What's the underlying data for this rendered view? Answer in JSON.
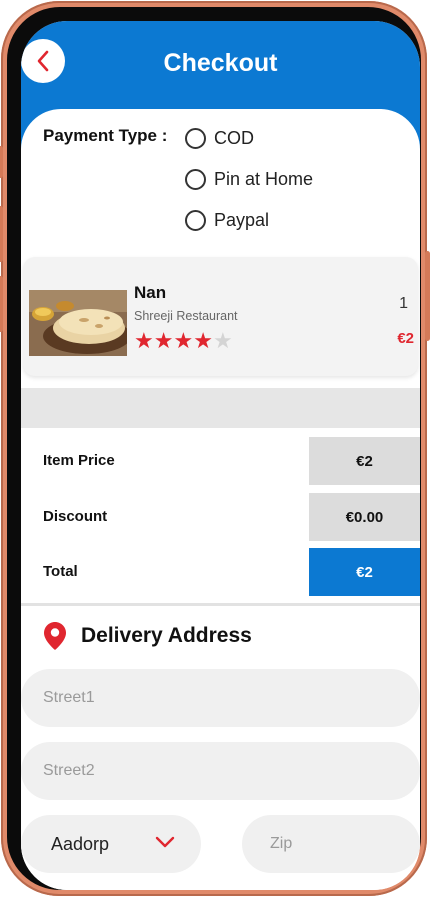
{
  "header": {
    "title": "Checkout",
    "back_icon": "chevron-left-icon"
  },
  "payment": {
    "label": "Payment Type :",
    "options": [
      "COD",
      "Pin at Home",
      "Paypal"
    ]
  },
  "item": {
    "name": "Nan",
    "restaurant": "Shreeji Restaurant",
    "rating": 4,
    "rating_max": 5,
    "quantity": "1",
    "price": "€2"
  },
  "pricing": {
    "item_price_label": "Item Price",
    "item_price_value": "€2",
    "discount_label": "Discount",
    "discount_value": "€0.00",
    "total_label": "Total",
    "total_value": "€2"
  },
  "address": {
    "title": "Delivery Address",
    "icon": "map-pin-icon",
    "street1_placeholder": "Street1",
    "street2_placeholder": "Street2",
    "city": "Aadorp",
    "zip_placeholder": "Zip"
  },
  "colors": {
    "brand_blue": "#0c79d2",
    "accent_red": "#e0262f"
  }
}
